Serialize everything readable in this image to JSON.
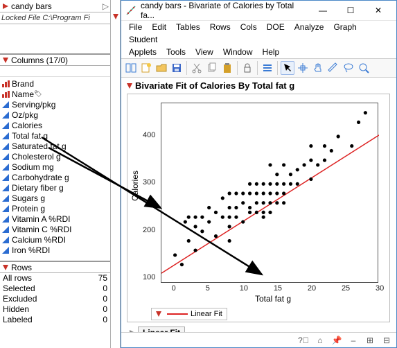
{
  "left": {
    "tab_title": "candy bars",
    "locked_label": "Locked File",
    "locked_path": "C:\\Program Fi",
    "columns_header": "Columns (17/0)",
    "search_placeholder": "",
    "columns": [
      {
        "name": "Brand",
        "icon": "red"
      },
      {
        "name": "Name",
        "icon": "red",
        "label_icon": true
      },
      {
        "name": "Serving/pkg",
        "icon": "blue"
      },
      {
        "name": "Oz/pkg",
        "icon": "blue"
      },
      {
        "name": "Calories",
        "icon": "blue"
      },
      {
        "name": "Total fat g",
        "icon": "blue"
      },
      {
        "name": "Saturated fat g",
        "icon": "blue"
      },
      {
        "name": "Cholesterol g",
        "icon": "blue"
      },
      {
        "name": "Sodium mg",
        "icon": "blue"
      },
      {
        "name": "Carbohydrate g",
        "icon": "blue"
      },
      {
        "name": "Dietary fiber g",
        "icon": "blue"
      },
      {
        "name": "Sugars g",
        "icon": "blue"
      },
      {
        "name": "Protein g",
        "icon": "blue"
      },
      {
        "name": "Vitamin A %RDI",
        "icon": "blue"
      },
      {
        "name": "Vitamin C %RDI",
        "icon": "blue"
      },
      {
        "name": "Calcium %RDI",
        "icon": "blue"
      },
      {
        "name": "Iron %RDI",
        "icon": "blue"
      }
    ],
    "rows_header": "Rows",
    "rows": [
      {
        "label": "All rows",
        "value": "75"
      },
      {
        "label": "Selected",
        "value": "0"
      },
      {
        "label": "Excluded",
        "value": "0"
      },
      {
        "label": "Hidden",
        "value": "0"
      },
      {
        "label": "Labeled",
        "value": "0"
      }
    ]
  },
  "window": {
    "title": "candy bars - Bivariate of Calories by Total fa...",
    "menus_row1": [
      "File",
      "Edit",
      "Tables",
      "Rows",
      "Cols",
      "DOE",
      "Analyze",
      "Graph",
      "Student"
    ],
    "menus_row2": [
      "Applets",
      "Tools",
      "View",
      "Window",
      "Help"
    ]
  },
  "report": {
    "title": "Bivariate Fit of Calories By Total fat g",
    "fit_legend": "Linear Fit",
    "fit_button": "Linear Fit"
  },
  "chart_data": {
    "type": "scatter",
    "title": "",
    "xlabel": "Total fat g",
    "ylabel": "Calories",
    "xlim": [
      -2,
      30
    ],
    "ylim": [
      90,
      470
    ],
    "xticks": [
      0,
      5,
      10,
      15,
      20,
      25,
      30
    ],
    "yticks": [
      100,
      200,
      300,
      400
    ],
    "points": [
      [
        0,
        150
      ],
      [
        1,
        130
      ],
      [
        1.5,
        220
      ],
      [
        2,
        180
      ],
      [
        2,
        230
      ],
      [
        3,
        210
      ],
      [
        3,
        230
      ],
      [
        3,
        160
      ],
      [
        4,
        230
      ],
      [
        4,
        200
      ],
      [
        5,
        250
      ],
      [
        5,
        220
      ],
      [
        6,
        240
      ],
      [
        6,
        190
      ],
      [
        7,
        270
      ],
      [
        7,
        230
      ],
      [
        8,
        230
      ],
      [
        8,
        250
      ],
      [
        8,
        210
      ],
      [
        8,
        280
      ],
      [
        8,
        180
      ],
      [
        9,
        250
      ],
      [
        9,
        230
      ],
      [
        9,
        280
      ],
      [
        10,
        220
      ],
      [
        10,
        260
      ],
      [
        10,
        280
      ],
      [
        11,
        250
      ],
      [
        11,
        240
      ],
      [
        11,
        280
      ],
      [
        11,
        300
      ],
      [
        12,
        240
      ],
      [
        12,
        260
      ],
      [
        12,
        280
      ],
      [
        12,
        300
      ],
      [
        13,
        260
      ],
      [
        13,
        240
      ],
      [
        13,
        280
      ],
      [
        13,
        300
      ],
      [
        13,
        230
      ],
      [
        14,
        260
      ],
      [
        14,
        280
      ],
      [
        14,
        300
      ],
      [
        14,
        240
      ],
      [
        14,
        340
      ],
      [
        15,
        280
      ],
      [
        15,
        260
      ],
      [
        15,
        300
      ],
      [
        15,
        320
      ],
      [
        16,
        280
      ],
      [
        16,
        300
      ],
      [
        16,
        260
      ],
      [
        16,
        340
      ],
      [
        17,
        300
      ],
      [
        17,
        320
      ],
      [
        18,
        300
      ],
      [
        18,
        330
      ],
      [
        19,
        340
      ],
      [
        20,
        310
      ],
      [
        20,
        350
      ],
      [
        20,
        380
      ],
      [
        21,
        340
      ],
      [
        22,
        350
      ],
      [
        22,
        380
      ],
      [
        23,
        370
      ],
      [
        24,
        400
      ],
      [
        26,
        380
      ],
      [
        27,
        430
      ],
      [
        28,
        450
      ]
    ],
    "fit_line": {
      "slope": 9.1,
      "intercept": 130,
      "color": "#d22"
    }
  }
}
